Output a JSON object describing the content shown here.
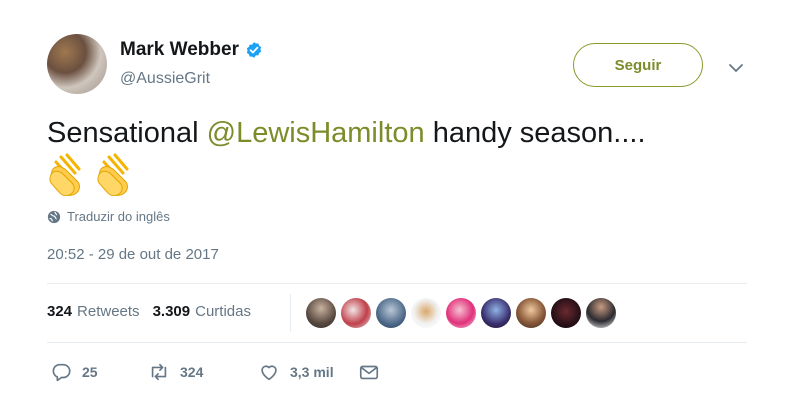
{
  "user": {
    "display_name": "Mark Webber",
    "handle": "@AussieGrit",
    "verified": true
  },
  "follow_button": {
    "label": "Seguir"
  },
  "tweet": {
    "text_before": "Sensational ",
    "mention": "@LewisHamilton",
    "text_after": " handy season....",
    "emojis": [
      "clapping-hands-emoji",
      "clapping-hands-emoji"
    ],
    "translate_label": "Traduzir do inglês",
    "timestamp": "20:52 - 29 de out de 2017"
  },
  "stats": {
    "retweets_count": "324",
    "retweets_label": "Retweets",
    "likes_count": "3.309",
    "likes_label": "Curtidas",
    "liker_avatar_count": 9
  },
  "actions": {
    "reply_count": "25",
    "retweet_count": "324",
    "like_count": "3,3 mil"
  },
  "colors": {
    "accent": "#7d8c2a",
    "verified": "#1da1f2",
    "muted": "#657786"
  }
}
